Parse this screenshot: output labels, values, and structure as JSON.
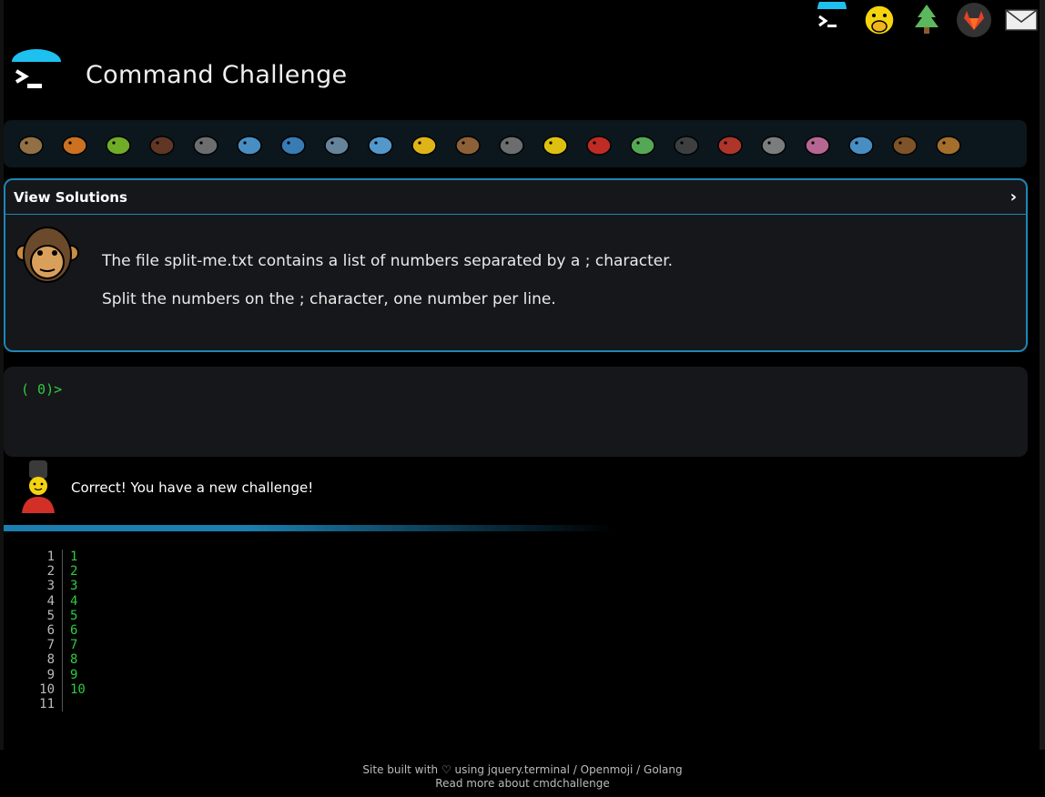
{
  "top_icons": [
    "terminal-icon",
    "face-hand-over-mouth-icon",
    "tree-icon",
    "gitlab-icon",
    "mail-icon"
  ],
  "header": {
    "title": "Command Challenge"
  },
  "animals": [
    "snail",
    "butterfly",
    "caterpillar",
    "ant",
    "spider-web",
    "whale",
    "shark",
    "dolphin",
    "fish",
    "tropical-fish",
    "blowfish",
    "wolf",
    "bee",
    "ladybug",
    "cricket",
    "spider",
    "scorpion",
    "fly",
    "worm",
    "microbe",
    "monkey",
    "dog"
  ],
  "challenge": {
    "toggle_label": "View Solutions",
    "line1": "The file split-me.txt contains a list of numbers separated by a ; character.",
    "line2": "Split the numbers on the ; character, one number per line."
  },
  "terminal": {
    "prompt": "( 0)>"
  },
  "message": {
    "text": "Correct! You have a new challenge!"
  },
  "output": {
    "lines": [
      {
        "n": "1",
        "v": "1"
      },
      {
        "n": "2",
        "v": "2"
      },
      {
        "n": "3",
        "v": "3"
      },
      {
        "n": "4",
        "v": "4"
      },
      {
        "n": "5",
        "v": "5"
      },
      {
        "n": "6",
        "v": "6"
      },
      {
        "n": "7",
        "v": "7"
      },
      {
        "n": "8",
        "v": "8"
      },
      {
        "n": "9",
        "v": "9"
      },
      {
        "n": "10",
        "v": "10"
      },
      {
        "n": "11",
        "v": ""
      }
    ]
  },
  "footer": {
    "line1": "Site built with ♡ using jquery.terminal / Openmoji / Golang",
    "line2": "Read more about cmdchallenge"
  },
  "colors": {
    "accent": "#1e86b5",
    "prompt": "#2ecc40",
    "background": "#000000"
  }
}
